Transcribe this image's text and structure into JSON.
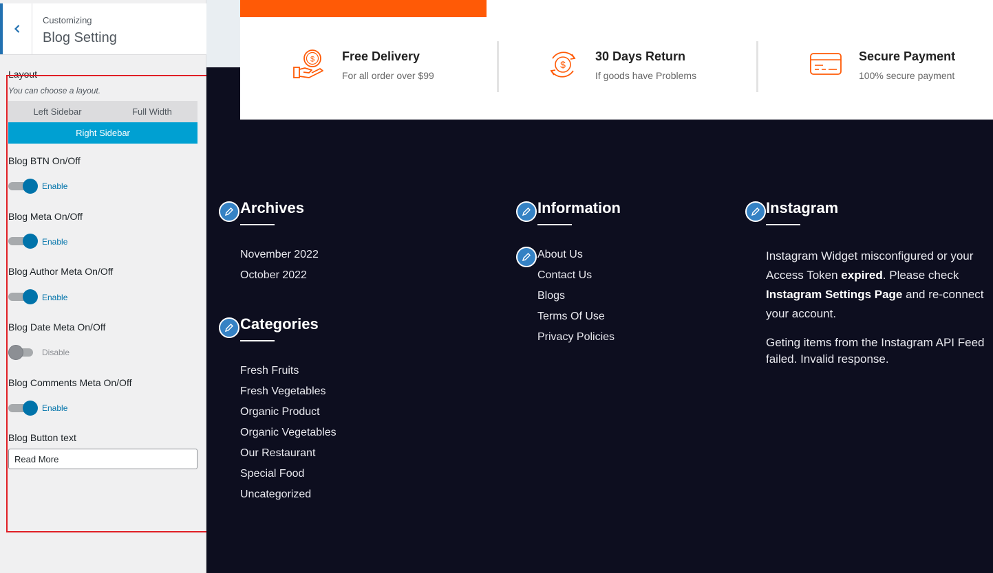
{
  "customizer": {
    "subtitle": "Customizing",
    "title": "Blog Setting",
    "layout": {
      "label": "Layout",
      "description": "You can choose a layout.",
      "options": [
        "Left Sidebar",
        "Full Width",
        "Right Sidebar"
      ],
      "selected": "Right Sidebar"
    },
    "toggles": [
      {
        "label": "Blog BTN On/Off",
        "state": "Enable",
        "on": true
      },
      {
        "label": "Blog Meta On/Off",
        "state": "Enable",
        "on": true
      },
      {
        "label": "Blog Author Meta On/Off",
        "state": "Enable",
        "on": true
      },
      {
        "label": "Blog Date Meta On/Off",
        "state": "Disable",
        "on": false
      },
      {
        "label": "Blog Comments Meta On/Off",
        "state": "Enable",
        "on": true
      }
    ],
    "button_text": {
      "label": "Blog Button text",
      "value": "Read More"
    }
  },
  "features": [
    {
      "title": "Free Delivery",
      "subtitle": "For all order over $99",
      "icon": "hand-money-icon"
    },
    {
      "title": "30 Days Return",
      "subtitle": "If goods have Problems",
      "icon": "money-return-icon"
    },
    {
      "title": "Secure Payment",
      "subtitle": "100% secure payment",
      "icon": "credit-card-icon"
    }
  ],
  "footer": {
    "archives": {
      "title": "Archives",
      "items": [
        "November 2022",
        "October 2022"
      ]
    },
    "categories": {
      "title": "Categories",
      "items": [
        "Fresh Fruits",
        "Fresh Vegetables",
        "Organic Product",
        "Organic Vegetables",
        "Our Restaurant",
        "Special Food",
        "Uncategorized"
      ]
    },
    "information": {
      "title": "Information",
      "items": [
        "About Us",
        "Contact Us",
        "Blogs",
        "Terms Of Use",
        "Privacy Policies"
      ]
    },
    "instagram": {
      "title": "Instagram",
      "msg_part1": "Instagram Widget misconfigured or your Access Token ",
      "msg_bold1": "expired",
      "msg_part2": ". Please check ",
      "msg_bold2": "Instagram Settings Page",
      "msg_part3": " and re-connect your account.",
      "error": "Geting items from the Instagram API Feed failed. Invalid response."
    }
  },
  "colors": {
    "accent_orange": "#ff5a06",
    "wp_blue": "#0073aa",
    "layout_selected": "#00a0d2",
    "footer_bg": "#0d0e1f",
    "highlight": "#e01e25"
  }
}
